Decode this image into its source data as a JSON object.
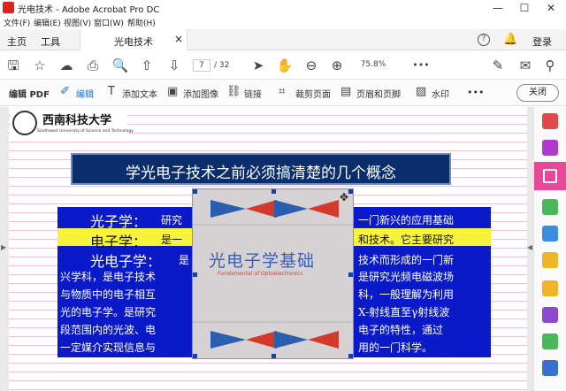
{
  "window": {
    "title": "光电技术 - Adobe Acrobat Pro DC",
    "controls": [
      "—",
      "☐",
      "✕"
    ]
  },
  "menu": [
    "文件(F)",
    "编辑(E)",
    "视图(V)",
    "窗口(W)",
    "帮助(H)"
  ],
  "tabs": {
    "home": "主页",
    "tools": "工具",
    "document": "光电技术",
    "close": "×",
    "login": "登录"
  },
  "toolbar": {
    "page_current": "7",
    "page_total": "/ 32",
    "zoom": "75.8%",
    "more": "•••"
  },
  "edit_toolbar": {
    "title": "编辑 PDF",
    "edit": "编辑",
    "add_text": "添加文本",
    "add_image": "添加图像",
    "link": "链接",
    "crop": "裁剪页面",
    "header_footer": "页眉和页脚",
    "watermark": "水印",
    "more": "•••",
    "close": "关闭"
  },
  "page": {
    "logo_text": "西南科技大学",
    "logo_subtext": "Southwest University of Science and Technology",
    "heading": "学光电子技术之前必须搞清楚的几个概念",
    "terms": [
      "光子学：",
      "电子学：",
      "光电子学："
    ],
    "lines": [
      "研究",
      "一门新兴的应用基础",
      "是一",
      "和技术。它主要研究",
      "是",
      "技术而形成的一门新",
      "兴学科，是电子技术",
      "是研究光频电磁波场",
      "与物质中的电子相互",
      "科，一般理解为利用",
      "光的电子学。是研究",
      "X-射线直至γ射线波",
      "段范围内的光波、电",
      "电子的特性，通过",
      "一定媒介实现信息与",
      "用的一门科学。"
    ],
    "book": {
      "title": "光电子学基础",
      "subtitle": "Fundamental of Optoelectronics"
    }
  },
  "colors": {
    "heading_bg": "#0b2d6b",
    "text_box_bg": "#0a1ac8",
    "highlight": "#f7f23a",
    "acrobat_red": "#d9261c",
    "edit_accent": "#1f6fd1"
  }
}
